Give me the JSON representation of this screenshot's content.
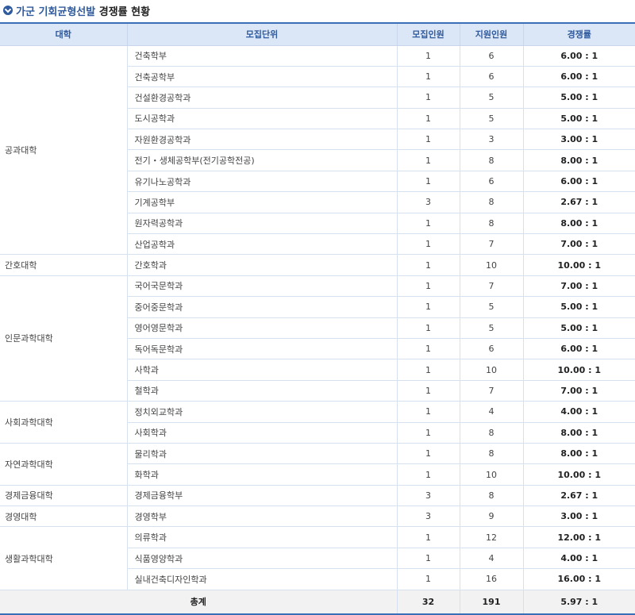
{
  "title": {
    "highlight": "가군 기회균형선발",
    "rest": "경쟁률 현황"
  },
  "headers": [
    "대학",
    "모집단위",
    "모집인원",
    "지원인원",
    "경쟁률"
  ],
  "groups": [
    {
      "college": "공과대학",
      "rows": [
        {
          "dept": "건축학부",
          "quota": "1",
          "applicants": "6",
          "ratio": "6.00 : 1"
        },
        {
          "dept": "건축공학부",
          "quota": "1",
          "applicants": "6",
          "ratio": "6.00 : 1"
        },
        {
          "dept": "건설환경공학과",
          "quota": "1",
          "applicants": "5",
          "ratio": "5.00 : 1"
        },
        {
          "dept": "도시공학과",
          "quota": "1",
          "applicants": "5",
          "ratio": "5.00 : 1"
        },
        {
          "dept": "자원환경공학과",
          "quota": "1",
          "applicants": "3",
          "ratio": "3.00 : 1"
        },
        {
          "dept": "전기・생체공학부(전기공학전공)",
          "quota": "1",
          "applicants": "8",
          "ratio": "8.00 : 1"
        },
        {
          "dept": "유기나노공학과",
          "quota": "1",
          "applicants": "6",
          "ratio": "6.00 : 1"
        },
        {
          "dept": "기계공학부",
          "quota": "3",
          "applicants": "8",
          "ratio": "2.67 : 1"
        },
        {
          "dept": "원자력공학과",
          "quota": "1",
          "applicants": "8",
          "ratio": "8.00 : 1"
        },
        {
          "dept": "산업공학과",
          "quota": "1",
          "applicants": "7",
          "ratio": "7.00 : 1"
        }
      ]
    },
    {
      "college": "간호대학",
      "rows": [
        {
          "dept": "간호학과",
          "quota": "1",
          "applicants": "10",
          "ratio": "10.00 : 1"
        }
      ]
    },
    {
      "college": "인문과학대학",
      "rows": [
        {
          "dept": "국어국문학과",
          "quota": "1",
          "applicants": "7",
          "ratio": "7.00 : 1"
        },
        {
          "dept": "중어중문학과",
          "quota": "1",
          "applicants": "5",
          "ratio": "5.00 : 1"
        },
        {
          "dept": "영어영문학과",
          "quota": "1",
          "applicants": "5",
          "ratio": "5.00 : 1"
        },
        {
          "dept": "독어독문학과",
          "quota": "1",
          "applicants": "6",
          "ratio": "6.00 : 1"
        },
        {
          "dept": "사학과",
          "quota": "1",
          "applicants": "10",
          "ratio": "10.00 : 1"
        },
        {
          "dept": "철학과",
          "quota": "1",
          "applicants": "7",
          "ratio": "7.00 : 1"
        }
      ]
    },
    {
      "college": "사회과학대학",
      "rows": [
        {
          "dept": "정치외교학과",
          "quota": "1",
          "applicants": "4",
          "ratio": "4.00 : 1"
        },
        {
          "dept": "사회학과",
          "quota": "1",
          "applicants": "8",
          "ratio": "8.00 : 1"
        }
      ]
    },
    {
      "college": "자연과학대학",
      "rows": [
        {
          "dept": "물리학과",
          "quota": "1",
          "applicants": "8",
          "ratio": "8.00 : 1"
        },
        {
          "dept": "화학과",
          "quota": "1",
          "applicants": "10",
          "ratio": "10.00 : 1"
        }
      ]
    },
    {
      "college": "경제금융대학",
      "rows": [
        {
          "dept": "경제금융학부",
          "quota": "3",
          "applicants": "8",
          "ratio": "2.67 : 1"
        }
      ]
    },
    {
      "college": "경영대학",
      "rows": [
        {
          "dept": "경영학부",
          "quota": "3",
          "applicants": "9",
          "ratio": "3.00 : 1"
        }
      ]
    },
    {
      "college": "생활과학대학",
      "rows": [
        {
          "dept": "의류학과",
          "quota": "1",
          "applicants": "12",
          "ratio": "12.00 : 1"
        },
        {
          "dept": "식품영양학과",
          "quota": "1",
          "applicants": "4",
          "ratio": "4.00 : 1"
        },
        {
          "dept": "실내건축디자인학과",
          "quota": "1",
          "applicants": "16",
          "ratio": "16.00 : 1"
        }
      ]
    }
  ],
  "total": {
    "label": "총계",
    "quota": "32",
    "applicants": "191",
    "ratio": "5.97 : 1"
  },
  "colors": {
    "accent": "#2f5a9e",
    "header_bg": "#dbe7f7",
    "border": "#d6e1ef"
  }
}
